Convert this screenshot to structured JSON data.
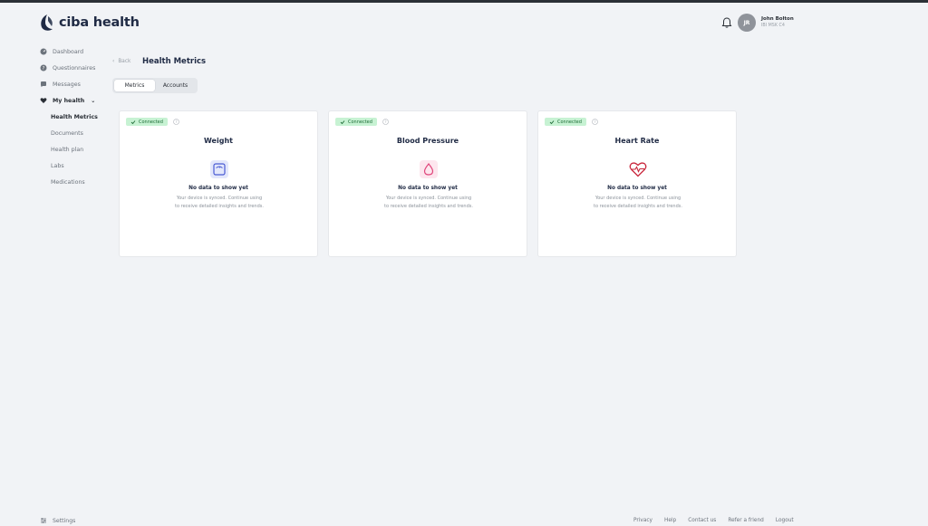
{
  "app": {
    "logo_text": "ciba health"
  },
  "header": {
    "user_initials": "JR",
    "user_name": "John Bolton",
    "user_sub": "IBI MSK C4"
  },
  "sidebar": {
    "items": [
      {
        "label": "Dashboard",
        "icon": "dashboard-icon"
      },
      {
        "label": "Questionnaires",
        "icon": "question-icon"
      },
      {
        "label": "Messages",
        "icon": "chat-icon"
      },
      {
        "label": "My health",
        "icon": "heart-icon"
      }
    ],
    "subitems": [
      "Health Metrics",
      "Documents",
      "Health plan",
      "Labs",
      "Medications"
    ],
    "settings_label": "Settings"
  },
  "main": {
    "back_label": "Back",
    "title": "Health Metrics",
    "tabs": [
      "Metrics",
      "Accounts"
    ]
  },
  "cards": [
    {
      "badge": "Connected",
      "title": "Weight",
      "icon": "scale-icon",
      "nodata": "No data to show yet",
      "desc": "Your device is synced. Continue using to receive detailed insights and trends."
    },
    {
      "badge": "Connected",
      "title": "Blood Pressure",
      "icon": "drop-icon",
      "nodata": "No data to show yet",
      "desc": "Your device is synced. Continue using to receive detailed insights and trends."
    },
    {
      "badge": "Connected",
      "title": "Heart Rate",
      "icon": "heart-rate-icon",
      "nodata": "No data to show yet",
      "desc": "Your device is synced. Continue using to receive detailed insights and trends."
    }
  ],
  "footer": [
    "Privacy",
    "Help",
    "Contact us",
    "Refer a friend",
    "Logout"
  ],
  "colors": {
    "background": "#f1f3f6",
    "badge_bg": "#c7f2d3",
    "weight_icon": "#4a5bd4",
    "bp_icon": "#e0457b",
    "heart_icon": "#c9283d"
  }
}
